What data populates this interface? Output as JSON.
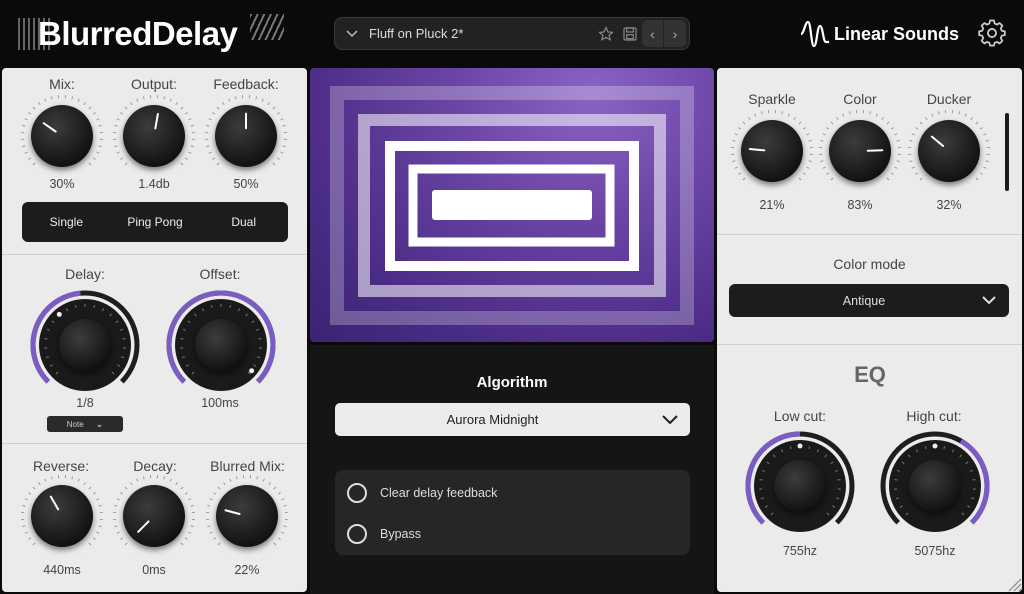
{
  "header": {
    "logo_text": "BlurredDelay",
    "preset_name": "Fluff on Pluck 2*",
    "brand_name": "Linear Sounds",
    "icons": [
      "chevron-down-icon",
      "star-icon",
      "save-icon",
      "chevron-left-icon",
      "chevron-right-icon",
      "waveform-icon",
      "gear-icon"
    ]
  },
  "left": {
    "mix": {
      "label": "Mix:",
      "value": "30%"
    },
    "output": {
      "label": "Output:",
      "value": "1.4db"
    },
    "feedback": {
      "label": "Feedback:",
      "value": "50%"
    },
    "modes": [
      "Single",
      "Ping Pong",
      "Dual"
    ],
    "delay": {
      "label": "Delay:",
      "value": "1/8"
    },
    "offset": {
      "label": "Offset:",
      "value": "100ms"
    },
    "note_dropdown": "Note",
    "reverse": {
      "label": "Reverse:",
      "value": "440ms"
    },
    "decay": {
      "label": "Decay:",
      "value": "0ms"
    },
    "blurred_mix": {
      "label": "Blurred Mix:",
      "value": "22%"
    }
  },
  "center": {
    "algorithm_title": "Algorithm",
    "algorithm_value": "Aurora Midnight",
    "options": [
      "Clear delay feedback",
      "Bypass"
    ]
  },
  "right": {
    "sparkle": {
      "label": "Sparkle",
      "value": "21%"
    },
    "color": {
      "label": "Color",
      "value": "83%"
    },
    "ducker": {
      "label": "Ducker",
      "value": "32%"
    },
    "color_mode_label": "Color mode",
    "color_mode_value": "Antique",
    "eq_title": "EQ",
    "low_cut": {
      "label": "Low cut:",
      "value": "755hz"
    },
    "high_cut": {
      "label": "High cut:",
      "value": "5075hz"
    }
  },
  "colors": {
    "accent": "#7b5cc4",
    "panel": "#ebebeb",
    "dark": "#0a0a0a",
    "visual": "#5a3a95"
  }
}
